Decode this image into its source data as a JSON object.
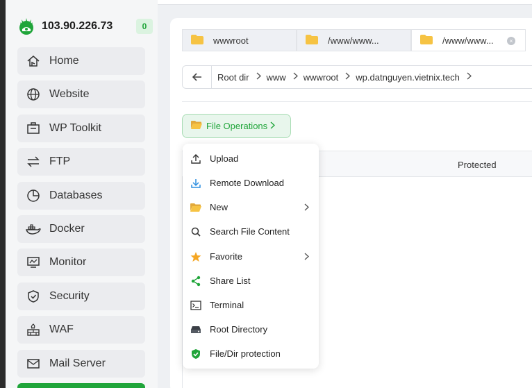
{
  "brand": {
    "ip": "103.90.226.73",
    "badge": "0"
  },
  "sidebar": {
    "items": [
      {
        "label": "Home",
        "icon": "home-icon"
      },
      {
        "label": "Website",
        "icon": "globe-icon"
      },
      {
        "label": "WP Toolkit",
        "icon": "briefcase-icon"
      },
      {
        "label": "FTP",
        "icon": "transfer-icon"
      },
      {
        "label": "Databases",
        "icon": "database-icon"
      },
      {
        "label": "Docker",
        "icon": "docker-icon"
      },
      {
        "label": "Monitor",
        "icon": "monitor-icon"
      },
      {
        "label": "Security",
        "icon": "shield-icon"
      },
      {
        "label": "WAF",
        "icon": "firewall-icon"
      },
      {
        "label": "Mail Server",
        "icon": "mail-icon"
      }
    ]
  },
  "tabs": [
    {
      "label": "wwwroot"
    },
    {
      "label": "/www/www..."
    },
    {
      "label": "/www/www..."
    }
  ],
  "breadcrumb": [
    "Root dir",
    "www",
    "wwwroot",
    "wp.datnguyen.vietnix.tech"
  ],
  "file_operations": {
    "label": "File Operations"
  },
  "table": {
    "protected_header": "Protected"
  },
  "menu": {
    "items": [
      {
        "label": "Upload",
        "icon": "upload-icon"
      },
      {
        "label": "Remote Download",
        "icon": "download-icon"
      },
      {
        "label": "New",
        "icon": "folder-icon"
      },
      {
        "label": "Search File Content",
        "icon": "search-icon"
      },
      {
        "label": "Favorite",
        "icon": "star-icon"
      },
      {
        "label": "Share List",
        "icon": "share-icon"
      },
      {
        "label": "Terminal",
        "icon": "terminal-icon"
      },
      {
        "label": "Root Directory",
        "icon": "drive-icon"
      },
      {
        "label": "File/Dir protection",
        "icon": "shield-check-icon"
      }
    ]
  },
  "colors": {
    "accent": "#20a53a",
    "folder": "#f6c343",
    "sidebar_bg": "#f5f6f7"
  }
}
